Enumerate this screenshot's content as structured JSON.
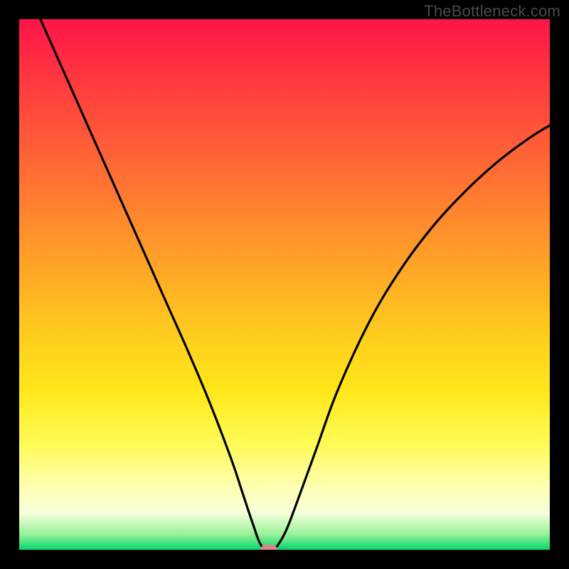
{
  "watermark": "TheBottleneck.com",
  "chart_data": {
    "type": "line",
    "title": "",
    "xlabel": "",
    "ylabel": "",
    "xlim": [
      0,
      100
    ],
    "ylim": [
      0,
      100
    ],
    "grid": false,
    "legend": false,
    "series": [
      {
        "name": "curve",
        "x": [
          4,
          8,
          12,
          16,
          20,
          24,
          28,
          32,
          36,
          40,
          42,
          44,
          45.5,
          47,
          48,
          50,
          52,
          56,
          60,
          66,
          72,
          78,
          84,
          90,
          96,
          100
        ],
        "y": [
          100,
          91,
          82,
          73,
          64,
          55,
          46,
          37,
          27.5,
          17,
          11,
          5,
          1,
          0,
          0,
          3,
          8,
          19,
          30,
          43,
          53,
          61,
          67.5,
          73,
          77.5,
          80
        ]
      }
    ],
    "marker": {
      "x": 47,
      "y": 0,
      "color": "#d98585"
    },
    "background_gradient": {
      "stops": [
        {
          "pos": 0,
          "color": "#ff1448"
        },
        {
          "pos": 12,
          "color": "#ff3a3f"
        },
        {
          "pos": 28,
          "color": "#ff6a34"
        },
        {
          "pos": 45,
          "color": "#ffa028"
        },
        {
          "pos": 58,
          "color": "#ffc81f"
        },
        {
          "pos": 70,
          "color": "#ffe81a"
        },
        {
          "pos": 80,
          "color": "#fffb55"
        },
        {
          "pos": 88,
          "color": "#ffffb0"
        },
        {
          "pos": 93,
          "color": "#f7ffdb"
        },
        {
          "pos": 97,
          "color": "#9af29a"
        },
        {
          "pos": 100,
          "color": "#06d66d"
        }
      ]
    }
  }
}
